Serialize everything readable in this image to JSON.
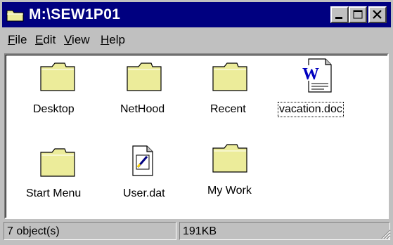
{
  "window": {
    "title": "M:\\SEW1P01"
  },
  "menu": [
    {
      "label": "File",
      "underline": "F",
      "rest": "ile"
    },
    {
      "label": "Edit",
      "underline": "E",
      "rest": "dit"
    },
    {
      "label": "View",
      "underline": "V",
      "rest": "iew"
    },
    {
      "label": "Help",
      "underline": "H",
      "rest": "elp"
    }
  ],
  "items": [
    {
      "name": "Desktop",
      "kind": "folder-icon"
    },
    {
      "name": "NetHood",
      "kind": "folder-icon"
    },
    {
      "name": "Recent",
      "kind": "folder-icon"
    },
    {
      "name": "vacation.doc",
      "kind": "word-document-icon",
      "selected": true
    },
    {
      "name": "Start Menu",
      "kind": "folder-icon"
    },
    {
      "name": "User.dat",
      "kind": "data-file-icon"
    },
    {
      "name": "My Work",
      "kind": "folder-icon"
    }
  ],
  "status": {
    "objects": "7 object(s)",
    "size": "191KB"
  },
  "colors": {
    "titlebar": "#000080",
    "face": "#c0c0c0",
    "folder": "#ecec9a"
  }
}
